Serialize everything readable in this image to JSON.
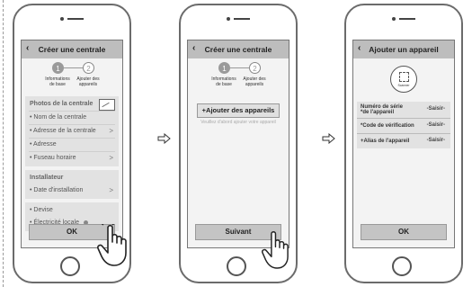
{
  "phone1": {
    "title": "Créer une centrale",
    "step1": "1",
    "step2": "2",
    "step1_label_l1": "Informations",
    "step1_label_l2": "de base",
    "step2_label_l1": "Ajouter des",
    "step2_label_l2": "appareils",
    "group1": {
      "photos": "Photos de la centrale",
      "rows": [
        "• Nom de la centrale",
        "• Adresse de la centrale",
        "• Adresse",
        "• Fuseau horaire"
      ]
    },
    "group2": {
      "head": "Installateur",
      "row": "• Date d'installation"
    },
    "group3": {
      "rows": [
        "• Devise",
        "• Électricité locale"
      ]
    },
    "ok": "OK"
  },
  "phone2": {
    "title": "Créer une centrale",
    "step1": "1",
    "step2": "2",
    "step1_label_l1": "Informations",
    "step1_label_l2": "de base",
    "step2_label_l1": "Ajouter des",
    "step2_label_l2": "appareils",
    "add_button": "+Ajouter des appareils",
    "hint": "Veuillez d'abord ajouter votre appareil",
    "next": "Suivant"
  },
  "phone3": {
    "title": "Ajouter un appareil",
    "scan_label": "Scanner",
    "fields": [
      {
        "label_l1": "Numéro de série",
        "label_l2": "*de l'appareil",
        "value": "-Saisir-"
      },
      {
        "label_l1": "*Code de vérification",
        "label_l2": "",
        "value": "-Saisir-"
      },
      {
        "label_l1": "+Alias de l'appareil",
        "label_l2": "",
        "value": "-Saisir-"
      }
    ],
    "ok": "OK"
  },
  "icons": [
    "back-chevron-icon",
    "image-upload-icon",
    "chevron-right-icon",
    "info-icon",
    "scan-icon",
    "right-arrow-icon",
    "pointing-hand-icon"
  ],
  "colors": {
    "header": "#bdbdbd",
    "screen_bg": "#f3f3f3",
    "group_bg": "#e2e2e2",
    "button": "#c4c4c4"
  }
}
